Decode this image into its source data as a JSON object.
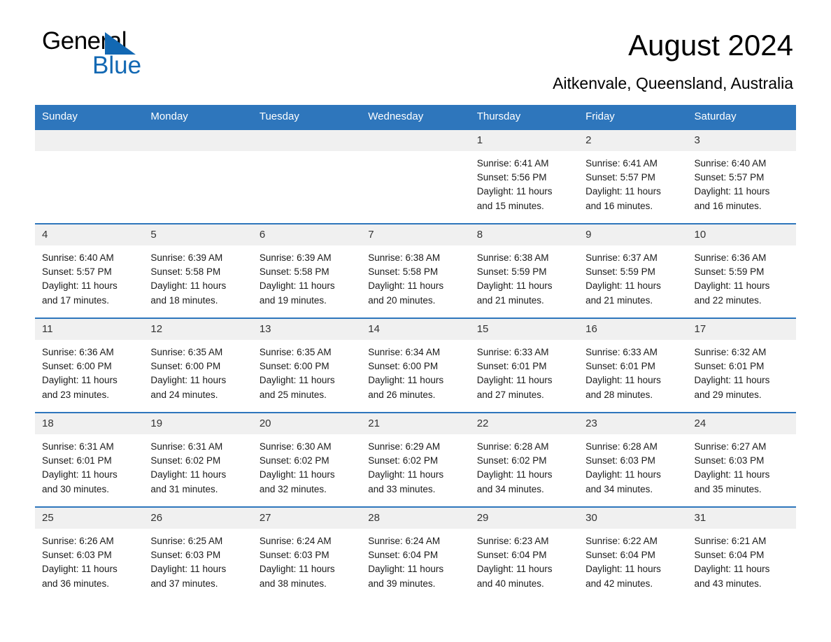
{
  "brand": {
    "name_line1": "General",
    "name_line2": "Blue",
    "accent_color": "#1268b3"
  },
  "header": {
    "title": "August 2024",
    "subtitle": "Aitkenvale, Queensland, Australia"
  },
  "theme": {
    "header_bar_color": "#2e76bc",
    "daynum_band_color": "#f0f0f0",
    "page_background": "#ffffff"
  },
  "weekday_headers": [
    "Sunday",
    "Monday",
    "Tuesday",
    "Wednesday",
    "Thursday",
    "Friday",
    "Saturday"
  ],
  "weeks": [
    [
      {
        "day": "",
        "sunrise": "",
        "sunset": "",
        "daylight1": "",
        "daylight2": "",
        "empty": true
      },
      {
        "day": "",
        "sunrise": "",
        "sunset": "",
        "daylight1": "",
        "daylight2": "",
        "empty": true
      },
      {
        "day": "",
        "sunrise": "",
        "sunset": "",
        "daylight1": "",
        "daylight2": "",
        "empty": true
      },
      {
        "day": "",
        "sunrise": "",
        "sunset": "",
        "daylight1": "",
        "daylight2": "",
        "empty": true
      },
      {
        "day": "1",
        "sunrise": "Sunrise: 6:41 AM",
        "sunset": "Sunset: 5:56 PM",
        "daylight1": "Daylight: 11 hours",
        "daylight2": "and 15 minutes."
      },
      {
        "day": "2",
        "sunrise": "Sunrise: 6:41 AM",
        "sunset": "Sunset: 5:57 PM",
        "daylight1": "Daylight: 11 hours",
        "daylight2": "and 16 minutes."
      },
      {
        "day": "3",
        "sunrise": "Sunrise: 6:40 AM",
        "sunset": "Sunset: 5:57 PM",
        "daylight1": "Daylight: 11 hours",
        "daylight2": "and 16 minutes."
      }
    ],
    [
      {
        "day": "4",
        "sunrise": "Sunrise: 6:40 AM",
        "sunset": "Sunset: 5:57 PM",
        "daylight1": "Daylight: 11 hours",
        "daylight2": "and 17 minutes."
      },
      {
        "day": "5",
        "sunrise": "Sunrise: 6:39 AM",
        "sunset": "Sunset: 5:58 PM",
        "daylight1": "Daylight: 11 hours",
        "daylight2": "and 18 minutes."
      },
      {
        "day": "6",
        "sunrise": "Sunrise: 6:39 AM",
        "sunset": "Sunset: 5:58 PM",
        "daylight1": "Daylight: 11 hours",
        "daylight2": "and 19 minutes."
      },
      {
        "day": "7",
        "sunrise": "Sunrise: 6:38 AM",
        "sunset": "Sunset: 5:58 PM",
        "daylight1": "Daylight: 11 hours",
        "daylight2": "and 20 minutes."
      },
      {
        "day": "8",
        "sunrise": "Sunrise: 6:38 AM",
        "sunset": "Sunset: 5:59 PM",
        "daylight1": "Daylight: 11 hours",
        "daylight2": "and 21 minutes."
      },
      {
        "day": "9",
        "sunrise": "Sunrise: 6:37 AM",
        "sunset": "Sunset: 5:59 PM",
        "daylight1": "Daylight: 11 hours",
        "daylight2": "and 21 minutes."
      },
      {
        "day": "10",
        "sunrise": "Sunrise: 6:36 AM",
        "sunset": "Sunset: 5:59 PM",
        "daylight1": "Daylight: 11 hours",
        "daylight2": "and 22 minutes."
      }
    ],
    [
      {
        "day": "11",
        "sunrise": "Sunrise: 6:36 AM",
        "sunset": "Sunset: 6:00 PM",
        "daylight1": "Daylight: 11 hours",
        "daylight2": "and 23 minutes."
      },
      {
        "day": "12",
        "sunrise": "Sunrise: 6:35 AM",
        "sunset": "Sunset: 6:00 PM",
        "daylight1": "Daylight: 11 hours",
        "daylight2": "and 24 minutes."
      },
      {
        "day": "13",
        "sunrise": "Sunrise: 6:35 AM",
        "sunset": "Sunset: 6:00 PM",
        "daylight1": "Daylight: 11 hours",
        "daylight2": "and 25 minutes."
      },
      {
        "day": "14",
        "sunrise": "Sunrise: 6:34 AM",
        "sunset": "Sunset: 6:00 PM",
        "daylight1": "Daylight: 11 hours",
        "daylight2": "and 26 minutes."
      },
      {
        "day": "15",
        "sunrise": "Sunrise: 6:33 AM",
        "sunset": "Sunset: 6:01 PM",
        "daylight1": "Daylight: 11 hours",
        "daylight2": "and 27 minutes."
      },
      {
        "day": "16",
        "sunrise": "Sunrise: 6:33 AM",
        "sunset": "Sunset: 6:01 PM",
        "daylight1": "Daylight: 11 hours",
        "daylight2": "and 28 minutes."
      },
      {
        "day": "17",
        "sunrise": "Sunrise: 6:32 AM",
        "sunset": "Sunset: 6:01 PM",
        "daylight1": "Daylight: 11 hours",
        "daylight2": "and 29 minutes."
      }
    ],
    [
      {
        "day": "18",
        "sunrise": "Sunrise: 6:31 AM",
        "sunset": "Sunset: 6:01 PM",
        "daylight1": "Daylight: 11 hours",
        "daylight2": "and 30 minutes."
      },
      {
        "day": "19",
        "sunrise": "Sunrise: 6:31 AM",
        "sunset": "Sunset: 6:02 PM",
        "daylight1": "Daylight: 11 hours",
        "daylight2": "and 31 minutes."
      },
      {
        "day": "20",
        "sunrise": "Sunrise: 6:30 AM",
        "sunset": "Sunset: 6:02 PM",
        "daylight1": "Daylight: 11 hours",
        "daylight2": "and 32 minutes."
      },
      {
        "day": "21",
        "sunrise": "Sunrise: 6:29 AM",
        "sunset": "Sunset: 6:02 PM",
        "daylight1": "Daylight: 11 hours",
        "daylight2": "and 33 minutes."
      },
      {
        "day": "22",
        "sunrise": "Sunrise: 6:28 AM",
        "sunset": "Sunset: 6:02 PM",
        "daylight1": "Daylight: 11 hours",
        "daylight2": "and 34 minutes."
      },
      {
        "day": "23",
        "sunrise": "Sunrise: 6:28 AM",
        "sunset": "Sunset: 6:03 PM",
        "daylight1": "Daylight: 11 hours",
        "daylight2": "and 34 minutes."
      },
      {
        "day": "24",
        "sunrise": "Sunrise: 6:27 AM",
        "sunset": "Sunset: 6:03 PM",
        "daylight1": "Daylight: 11 hours",
        "daylight2": "and 35 minutes."
      }
    ],
    [
      {
        "day": "25",
        "sunrise": "Sunrise: 6:26 AM",
        "sunset": "Sunset: 6:03 PM",
        "daylight1": "Daylight: 11 hours",
        "daylight2": "and 36 minutes."
      },
      {
        "day": "26",
        "sunrise": "Sunrise: 6:25 AM",
        "sunset": "Sunset: 6:03 PM",
        "daylight1": "Daylight: 11 hours",
        "daylight2": "and 37 minutes."
      },
      {
        "day": "27",
        "sunrise": "Sunrise: 6:24 AM",
        "sunset": "Sunset: 6:03 PM",
        "daylight1": "Daylight: 11 hours",
        "daylight2": "and 38 minutes."
      },
      {
        "day": "28",
        "sunrise": "Sunrise: 6:24 AM",
        "sunset": "Sunset: 6:04 PM",
        "daylight1": "Daylight: 11 hours",
        "daylight2": "and 39 minutes."
      },
      {
        "day": "29",
        "sunrise": "Sunrise: 6:23 AM",
        "sunset": "Sunset: 6:04 PM",
        "daylight1": "Daylight: 11 hours",
        "daylight2": "and 40 minutes."
      },
      {
        "day": "30",
        "sunrise": "Sunrise: 6:22 AM",
        "sunset": "Sunset: 6:04 PM",
        "daylight1": "Daylight: 11 hours",
        "daylight2": "and 42 minutes."
      },
      {
        "day": "31",
        "sunrise": "Sunrise: 6:21 AM",
        "sunset": "Sunset: 6:04 PM",
        "daylight1": "Daylight: 11 hours",
        "daylight2": "and 43 minutes."
      }
    ]
  ]
}
